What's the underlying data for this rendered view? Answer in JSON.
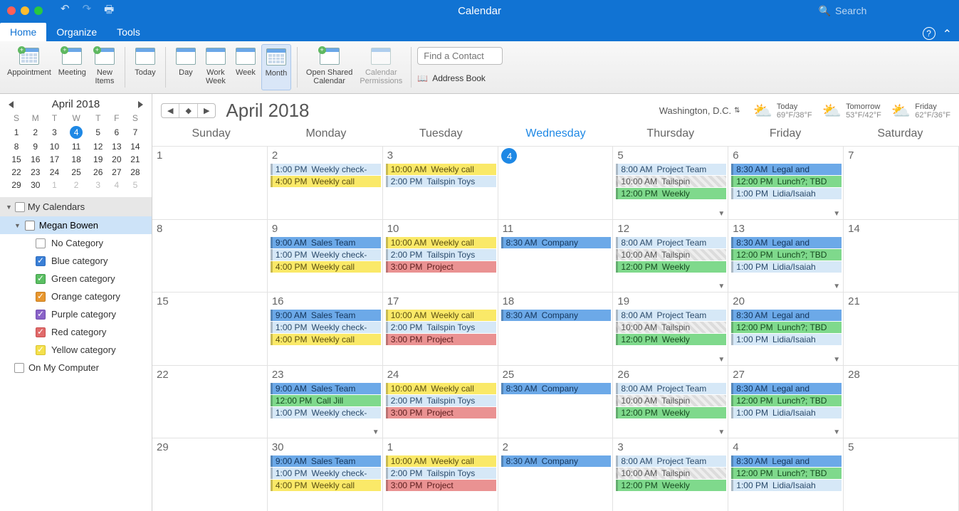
{
  "titlebar": {
    "title": "Calendar",
    "search_placeholder": "Search"
  },
  "tabs": {
    "home": "Home",
    "organize": "Organize",
    "tools": "Tools"
  },
  "ribbon": {
    "appointment": "Appointment",
    "meeting": "Meeting",
    "new_items": "New\nItems",
    "today": "Today",
    "day": "Day",
    "work_week": "Work\nWeek",
    "week": "Week",
    "month": "Month",
    "open_shared": "Open Shared\nCalendar",
    "permissions": "Calendar\nPermissions",
    "find_contact_placeholder": "Find a Contact",
    "address_book": "Address Book"
  },
  "sidebar": {
    "month_label": "April 2018",
    "dow": [
      "S",
      "M",
      "T",
      "W",
      "T",
      "F",
      "S"
    ],
    "weeks": [
      [
        {
          "d": 1
        },
        {
          "d": 2
        },
        {
          "d": 3
        },
        {
          "d": 4,
          "today": true
        },
        {
          "d": 5
        },
        {
          "d": 6
        },
        {
          "d": 7
        }
      ],
      [
        {
          "d": 8
        },
        {
          "d": 9
        },
        {
          "d": 10
        },
        {
          "d": 11
        },
        {
          "d": 12
        },
        {
          "d": 13
        },
        {
          "d": 14
        }
      ],
      [
        {
          "d": 15
        },
        {
          "d": 16
        },
        {
          "d": 17
        },
        {
          "d": 18
        },
        {
          "d": 19
        },
        {
          "d": 20
        },
        {
          "d": 21
        }
      ],
      [
        {
          "d": 22
        },
        {
          "d": 23
        },
        {
          "d": 24
        },
        {
          "d": 25
        },
        {
          "d": 26
        },
        {
          "d": 27
        },
        {
          "d": 28
        }
      ],
      [
        {
          "d": 29
        },
        {
          "d": 30
        },
        {
          "d": 1,
          "o": true
        },
        {
          "d": 2,
          "o": true
        },
        {
          "d": 3,
          "o": true
        },
        {
          "d": 4,
          "o": true
        },
        {
          "d": 5,
          "o": true
        }
      ]
    ],
    "my_calendars": "My Calendars",
    "megan": "Megan Bowen",
    "categories": [
      {
        "label": "No Category",
        "color": ""
      },
      {
        "label": "Blue category",
        "color": "blue"
      },
      {
        "label": "Green category",
        "color": "green"
      },
      {
        "label": "Orange category",
        "color": "orange"
      },
      {
        "label": "Purple category",
        "color": "purple"
      },
      {
        "label": "Red category",
        "color": "red"
      },
      {
        "label": "Yellow category",
        "color": "yellow"
      }
    ],
    "on_my_computer": "On My Computer"
  },
  "calheader": {
    "title": "April 2018",
    "location": "Washington,  D.C.",
    "weather": [
      {
        "label": "Today",
        "temp": "69°F/38°F",
        "icon": "⛅"
      },
      {
        "label": "Tomorrow",
        "temp": "53°F/42°F",
        "icon": "⛅"
      },
      {
        "label": "Friday",
        "temp": "62°F/36°F",
        "icon": "⛅"
      }
    ]
  },
  "dow_full": [
    "Sunday",
    "Monday",
    "Tuesday",
    "Wednesday",
    "Thursday",
    "Friday",
    "Saturday"
  ],
  "today_index": 3,
  "month_cells": [
    {
      "n": 1
    },
    {
      "n": 2,
      "ev": [
        {
          "t": "1:00 PM",
          "x": "Weekly check-",
          "c": "ltblue"
        },
        {
          "t": "4:00 PM",
          "x": "Weekly call",
          "c": "yellow"
        }
      ]
    },
    {
      "n": 3,
      "ev": [
        {
          "t": "10:00 AM",
          "x": "Weekly call",
          "c": "yellow"
        },
        {
          "t": "2:00 PM",
          "x": "Tailspin Toys",
          "c": "ltblue"
        }
      ]
    },
    {
      "n": 4,
      "today": true
    },
    {
      "n": 5,
      "more": true,
      "ev": [
        {
          "t": "8:00 AM",
          "x": "Project Team",
          "c": "ltblue"
        },
        {
          "t": "10:00 AM",
          "x": "Tailspin",
          "c": "striped"
        },
        {
          "t": "12:00 PM",
          "x": "Weekly",
          "c": "green"
        }
      ]
    },
    {
      "n": 6,
      "more": true,
      "ev": [
        {
          "t": "8:30 AM",
          "x": "Legal and",
          "c": "blue"
        },
        {
          "t": "12:00 PM",
          "x": "Lunch?; TBD",
          "c": "green"
        },
        {
          "t": "1:00 PM",
          "x": "Lidia/Isaiah",
          "c": "ltblue"
        }
      ]
    },
    {
      "n": 7
    },
    {
      "n": 8
    },
    {
      "n": 9,
      "ev": [
        {
          "t": "9:00 AM",
          "x": "Sales Team",
          "c": "blue"
        },
        {
          "t": "1:00 PM",
          "x": "Weekly check-",
          "c": "ltblue"
        },
        {
          "t": "4:00 PM",
          "x": "Weekly call",
          "c": "yellow"
        }
      ]
    },
    {
      "n": 10,
      "ev": [
        {
          "t": "10:00 AM",
          "x": "Weekly call",
          "c": "yellow"
        },
        {
          "t": "2:00 PM",
          "x": "Tailspin Toys",
          "c": "ltblue"
        },
        {
          "t": "3:00 PM",
          "x": "Project",
          "c": "red"
        }
      ]
    },
    {
      "n": 11,
      "ev": [
        {
          "t": "8:30 AM",
          "x": "Company",
          "c": "blue"
        }
      ]
    },
    {
      "n": 12,
      "more": true,
      "ev": [
        {
          "t": "8:00 AM",
          "x": "Project Team",
          "c": "ltblue"
        },
        {
          "t": "10:00 AM",
          "x": "Tailspin",
          "c": "striped"
        },
        {
          "t": "12:00 PM",
          "x": "Weekly",
          "c": "green"
        }
      ]
    },
    {
      "n": 13,
      "more": true,
      "ev": [
        {
          "t": "8:30 AM",
          "x": "Legal and",
          "c": "blue"
        },
        {
          "t": "12:00 PM",
          "x": "Lunch?; TBD",
          "c": "green"
        },
        {
          "t": "1:00 PM",
          "x": "Lidia/Isaiah",
          "c": "ltblue"
        }
      ]
    },
    {
      "n": 14
    },
    {
      "n": 15
    },
    {
      "n": 16,
      "ev": [
        {
          "t": "9:00 AM",
          "x": "Sales Team",
          "c": "blue"
        },
        {
          "t": "1:00 PM",
          "x": "Weekly check-",
          "c": "ltblue"
        },
        {
          "t": "4:00 PM",
          "x": "Weekly call",
          "c": "yellow"
        }
      ]
    },
    {
      "n": 17,
      "ev": [
        {
          "t": "10:00 AM",
          "x": "Weekly call",
          "c": "yellow"
        },
        {
          "t": "2:00 PM",
          "x": "Tailspin Toys",
          "c": "ltblue"
        },
        {
          "t": "3:00 PM",
          "x": "Project",
          "c": "red"
        }
      ]
    },
    {
      "n": 18,
      "ev": [
        {
          "t": "8:30 AM",
          "x": "Company",
          "c": "blue"
        }
      ]
    },
    {
      "n": 19,
      "more": true,
      "ev": [
        {
          "t": "8:00 AM",
          "x": "Project Team",
          "c": "ltblue"
        },
        {
          "t": "10:00 AM",
          "x": "Tailspin",
          "c": "striped"
        },
        {
          "t": "12:00 PM",
          "x": "Weekly",
          "c": "green"
        }
      ]
    },
    {
      "n": 20,
      "more": true,
      "ev": [
        {
          "t": "8:30 AM",
          "x": "Legal and",
          "c": "blue"
        },
        {
          "t": "12:00 PM",
          "x": "Lunch?; TBD",
          "c": "green"
        },
        {
          "t": "1:00 PM",
          "x": "Lidia/Isaiah",
          "c": "ltblue"
        }
      ]
    },
    {
      "n": 21
    },
    {
      "n": 22
    },
    {
      "n": 23,
      "more": true,
      "ev": [
        {
          "t": "9:00 AM",
          "x": "Sales Team",
          "c": "blue"
        },
        {
          "t": "12:00 PM",
          "x": "Call Jill",
          "c": "green"
        },
        {
          "t": "1:00 PM",
          "x": "Weekly check-",
          "c": "ltblue"
        }
      ]
    },
    {
      "n": 24,
      "ev": [
        {
          "t": "10:00 AM",
          "x": "Weekly call",
          "c": "yellow"
        },
        {
          "t": "2:00 PM",
          "x": "Tailspin Toys",
          "c": "ltblue"
        },
        {
          "t": "3:00 PM",
          "x": "Project",
          "c": "red"
        }
      ]
    },
    {
      "n": 25,
      "ev": [
        {
          "t": "8:30 AM",
          "x": "Company",
          "c": "blue"
        }
      ]
    },
    {
      "n": 26,
      "more": true,
      "ev": [
        {
          "t": "8:00 AM",
          "x": "Project Team",
          "c": "ltblue"
        },
        {
          "t": "10:00 AM",
          "x": "Tailspin",
          "c": "striped"
        },
        {
          "t": "12:00 PM",
          "x": "Weekly",
          "c": "green"
        }
      ]
    },
    {
      "n": 27,
      "more": true,
      "ev": [
        {
          "t": "8:30 AM",
          "x": "Legal and",
          "c": "blue"
        },
        {
          "t": "12:00 PM",
          "x": "Lunch?; TBD",
          "c": "green"
        },
        {
          "t": "1:00 PM",
          "x": "Lidia/Isaiah",
          "c": "ltblue"
        }
      ]
    },
    {
      "n": 28
    },
    {
      "n": 29
    },
    {
      "n": 30,
      "ev": [
        {
          "t": "9:00 AM",
          "x": "Sales Team",
          "c": "blue"
        },
        {
          "t": "1:00 PM",
          "x": "Weekly check-",
          "c": "ltblue"
        },
        {
          "t": "4:00 PM",
          "x": "Weekly call",
          "c": "yellow"
        }
      ]
    },
    {
      "n": 1,
      "ev": [
        {
          "t": "10:00 AM",
          "x": "Weekly call",
          "c": "yellow"
        },
        {
          "t": "2:00 PM",
          "x": "Tailspin Toys",
          "c": "ltblue"
        },
        {
          "t": "3:00 PM",
          "x": "Project",
          "c": "red"
        }
      ]
    },
    {
      "n": 2,
      "ev": [
        {
          "t": "8:30 AM",
          "x": "Company",
          "c": "blue"
        }
      ]
    },
    {
      "n": 3,
      "ev": [
        {
          "t": "8:00 AM",
          "x": "Project Team",
          "c": "ltblue"
        },
        {
          "t": "10:00 AM",
          "x": "Tailspin",
          "c": "striped"
        },
        {
          "t": "12:00 PM",
          "x": "Weekly",
          "c": "green"
        }
      ]
    },
    {
      "n": 4,
      "ev": [
        {
          "t": "8:30 AM",
          "x": "Legal and",
          "c": "blue"
        },
        {
          "t": "12:00 PM",
          "x": "Lunch?; TBD",
          "c": "green"
        },
        {
          "t": "1:00 PM",
          "x": "Lidia/Isaiah",
          "c": "ltblue"
        }
      ]
    },
    {
      "n": 5
    }
  ]
}
